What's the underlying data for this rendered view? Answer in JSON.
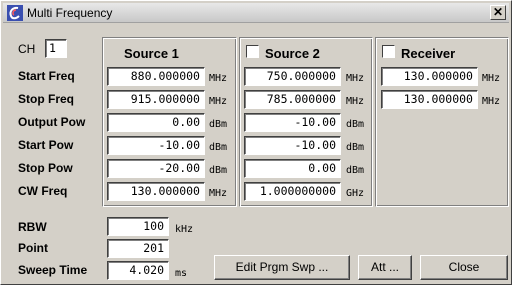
{
  "window": {
    "title": "Multi Frequency",
    "close_glyph": "✕"
  },
  "ch": {
    "label": "CH",
    "value": "1"
  },
  "row_labels": [
    "Start Freq",
    "Stop Freq",
    "Output Pow",
    "Start Pow",
    "Stop Pow",
    "CW Freq"
  ],
  "source1": {
    "title": "Source 1",
    "fields": [
      {
        "value": "880.000000",
        "unit": "MHz"
      },
      {
        "value": "915.000000",
        "unit": "MHz"
      },
      {
        "value": "0.00",
        "unit": "dBm"
      },
      {
        "value": "-10.00",
        "unit": "dBm"
      },
      {
        "value": "-20.00",
        "unit": "dBm"
      },
      {
        "value": "130.000000",
        "unit": "MHz"
      }
    ]
  },
  "source2": {
    "title": "Source 2",
    "checked": false,
    "fields": [
      {
        "value": "750.000000",
        "unit": "MHz"
      },
      {
        "value": "785.000000",
        "unit": "MHz"
      },
      {
        "value": "-10.00",
        "unit": "dBm"
      },
      {
        "value": "-10.00",
        "unit": "dBm"
      },
      {
        "value": "0.00",
        "unit": "dBm"
      },
      {
        "value": "1.000000000",
        "unit": "GHz"
      }
    ]
  },
  "receiver": {
    "title": "Receiver",
    "checked": false,
    "fields": [
      {
        "value": "130.000000",
        "unit": "MHz"
      },
      {
        "value": "130.000000",
        "unit": "MHz"
      }
    ]
  },
  "rbw": {
    "label": "RBW",
    "value": "100",
    "unit": "kHz"
  },
  "point": {
    "label": "Point",
    "value": "201"
  },
  "sweep_time": {
    "label": "Sweep Time",
    "value": "4.020",
    "unit": "ms"
  },
  "buttons": {
    "edit_prgm_swp": "Edit Prgm Swp ...",
    "att": "Att ...",
    "close": "Close"
  }
}
